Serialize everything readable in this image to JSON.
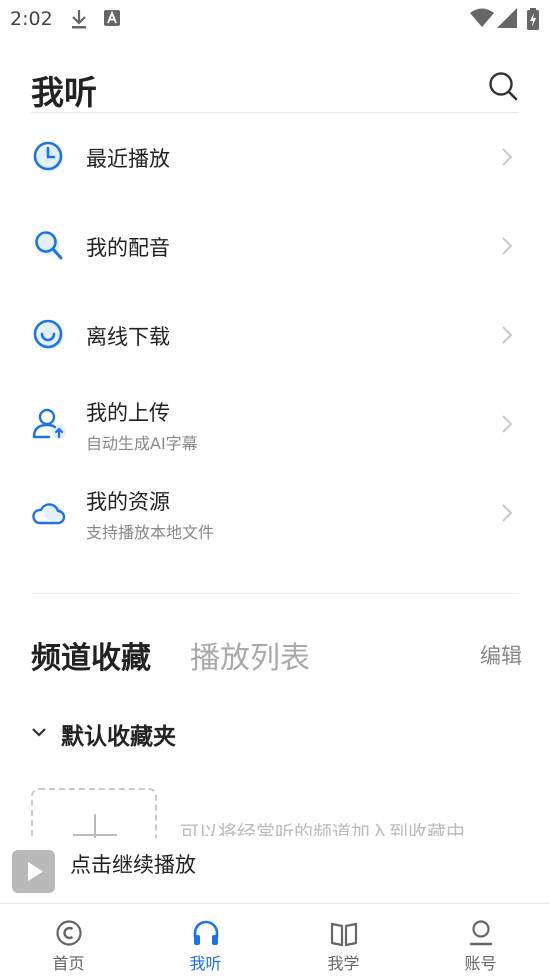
{
  "status_bar": {
    "time": "2:02"
  },
  "header": {
    "title": "我听"
  },
  "menu": {
    "items": [
      {
        "label": "最近播放",
        "sub": ""
      },
      {
        "label": "我的配音",
        "sub": ""
      },
      {
        "label": "离线下载",
        "sub": ""
      },
      {
        "label": "我的上传",
        "sub": "自动生成AI字幕"
      },
      {
        "label": "我的资源",
        "sub": "支持播放本地文件"
      }
    ]
  },
  "tabs": {
    "active": "频道收藏",
    "inactive": "播放列表",
    "edit": "编辑"
  },
  "folder": {
    "label": "默认收藏夹"
  },
  "empty_hint": "可以将经常听的频道加入到收藏中",
  "player": {
    "text": "点击继续播放"
  },
  "bottom_nav": {
    "items": [
      {
        "label": "首页"
      },
      {
        "label": "我听"
      },
      {
        "label": "我学"
      },
      {
        "label": "账号"
      }
    ]
  },
  "colors": {
    "accent": "#1a73e8",
    "text": "#222222",
    "muted": "#888888"
  }
}
